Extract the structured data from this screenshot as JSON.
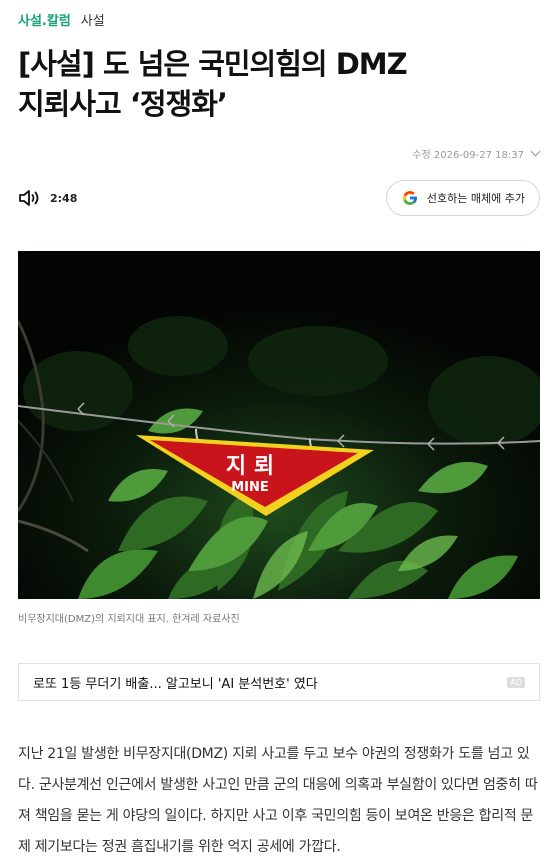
{
  "breadcrumb": {
    "section": "사설.칼럼",
    "subsection": "사설"
  },
  "headline": {
    "line1": "[사설] 도 넘은 국민의힘의 DMZ",
    "line2": "지뢰사고 ‘정쟁화’"
  },
  "meta": {
    "updated": "수정 2026-09-27 18:37"
  },
  "audio": {
    "duration": "2:48",
    "icon": "speaker-icon"
  },
  "google_button": {
    "label": "선호하는 매체에 추가",
    "icon": "google-g-icon"
  },
  "photo": {
    "sign_text_ko": "지 뢰",
    "sign_text_en": "MINE",
    "caption": "비무장지대(DMZ)의 지뢰지대 표지. 한겨레 자료사진"
  },
  "promo": {
    "text": "로또 1등 무더기 배출... 알고보니 'AI 분석번호' 였다",
    "badge": "AD"
  },
  "article": {
    "body": "지난 21일 발생한 비무장지대(DMZ) 지뢰 사고를 두고 보수 야권의 정쟁화가 도를 넘고 있다. 군사분계선 인근에서 발생한 사고인 만큼 군의 대응에 의혹과 부실함이 있다면 엄중히 따져 책임을 묻는 게 야당의 일이다. 하지만 사고 이후 국민의힘 등이 보여온 반응은 합리적 문제 제기보다는 정권 흠집내기를 위한 억지 공세에 가깝다."
  },
  "colors": {
    "accent": "#1aa37a",
    "sign_red": "#c8141a",
    "sign_yellow": "#f2d21f"
  }
}
